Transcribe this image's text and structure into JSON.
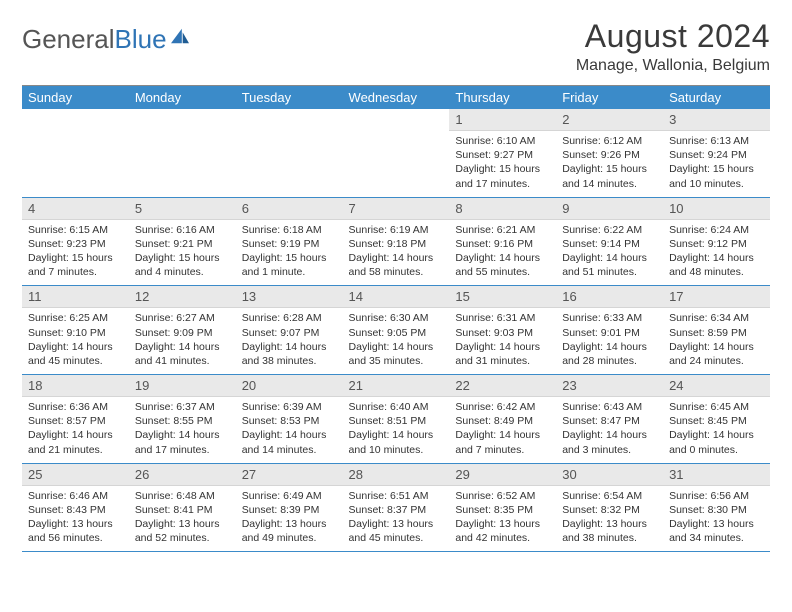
{
  "brand": {
    "part1": "General",
    "part2": "Blue"
  },
  "title": "August 2024",
  "subtitle": "Manage, Wallonia, Belgium",
  "dow": [
    "Sunday",
    "Monday",
    "Tuesday",
    "Wednesday",
    "Thursday",
    "Friday",
    "Saturday"
  ],
  "weeks": [
    [
      null,
      null,
      null,
      null,
      {
        "n": "1",
        "sr": "6:10 AM",
        "ss": "9:27 PM",
        "dl": "15 hours and 17 minutes."
      },
      {
        "n": "2",
        "sr": "6:12 AM",
        "ss": "9:26 PM",
        "dl": "15 hours and 14 minutes."
      },
      {
        "n": "3",
        "sr": "6:13 AM",
        "ss": "9:24 PM",
        "dl": "15 hours and 10 minutes."
      }
    ],
    [
      {
        "n": "4",
        "sr": "6:15 AM",
        "ss": "9:23 PM",
        "dl": "15 hours and 7 minutes."
      },
      {
        "n": "5",
        "sr": "6:16 AM",
        "ss": "9:21 PM",
        "dl": "15 hours and 4 minutes."
      },
      {
        "n": "6",
        "sr": "6:18 AM",
        "ss": "9:19 PM",
        "dl": "15 hours and 1 minute."
      },
      {
        "n": "7",
        "sr": "6:19 AM",
        "ss": "9:18 PM",
        "dl": "14 hours and 58 minutes."
      },
      {
        "n": "8",
        "sr": "6:21 AM",
        "ss": "9:16 PM",
        "dl": "14 hours and 55 minutes."
      },
      {
        "n": "9",
        "sr": "6:22 AM",
        "ss": "9:14 PM",
        "dl": "14 hours and 51 minutes."
      },
      {
        "n": "10",
        "sr": "6:24 AM",
        "ss": "9:12 PM",
        "dl": "14 hours and 48 minutes."
      }
    ],
    [
      {
        "n": "11",
        "sr": "6:25 AM",
        "ss": "9:10 PM",
        "dl": "14 hours and 45 minutes."
      },
      {
        "n": "12",
        "sr": "6:27 AM",
        "ss": "9:09 PM",
        "dl": "14 hours and 41 minutes."
      },
      {
        "n": "13",
        "sr": "6:28 AM",
        "ss": "9:07 PM",
        "dl": "14 hours and 38 minutes."
      },
      {
        "n": "14",
        "sr": "6:30 AM",
        "ss": "9:05 PM",
        "dl": "14 hours and 35 minutes."
      },
      {
        "n": "15",
        "sr": "6:31 AM",
        "ss": "9:03 PM",
        "dl": "14 hours and 31 minutes."
      },
      {
        "n": "16",
        "sr": "6:33 AM",
        "ss": "9:01 PM",
        "dl": "14 hours and 28 minutes."
      },
      {
        "n": "17",
        "sr": "6:34 AM",
        "ss": "8:59 PM",
        "dl": "14 hours and 24 minutes."
      }
    ],
    [
      {
        "n": "18",
        "sr": "6:36 AM",
        "ss": "8:57 PM",
        "dl": "14 hours and 21 minutes."
      },
      {
        "n": "19",
        "sr": "6:37 AM",
        "ss": "8:55 PM",
        "dl": "14 hours and 17 minutes."
      },
      {
        "n": "20",
        "sr": "6:39 AM",
        "ss": "8:53 PM",
        "dl": "14 hours and 14 minutes."
      },
      {
        "n": "21",
        "sr": "6:40 AM",
        "ss": "8:51 PM",
        "dl": "14 hours and 10 minutes."
      },
      {
        "n": "22",
        "sr": "6:42 AM",
        "ss": "8:49 PM",
        "dl": "14 hours and 7 minutes."
      },
      {
        "n": "23",
        "sr": "6:43 AM",
        "ss": "8:47 PM",
        "dl": "14 hours and 3 minutes."
      },
      {
        "n": "24",
        "sr": "6:45 AM",
        "ss": "8:45 PM",
        "dl": "14 hours and 0 minutes."
      }
    ],
    [
      {
        "n": "25",
        "sr": "6:46 AM",
        "ss": "8:43 PM",
        "dl": "13 hours and 56 minutes."
      },
      {
        "n": "26",
        "sr": "6:48 AM",
        "ss": "8:41 PM",
        "dl": "13 hours and 52 minutes."
      },
      {
        "n": "27",
        "sr": "6:49 AM",
        "ss": "8:39 PM",
        "dl": "13 hours and 49 minutes."
      },
      {
        "n": "28",
        "sr": "6:51 AM",
        "ss": "8:37 PM",
        "dl": "13 hours and 45 minutes."
      },
      {
        "n": "29",
        "sr": "6:52 AM",
        "ss": "8:35 PM",
        "dl": "13 hours and 42 minutes."
      },
      {
        "n": "30",
        "sr": "6:54 AM",
        "ss": "8:32 PM",
        "dl": "13 hours and 38 minutes."
      },
      {
        "n": "31",
        "sr": "6:56 AM",
        "ss": "8:30 PM",
        "dl": "13 hours and 34 minutes."
      }
    ]
  ],
  "labels": {
    "sunrise": "Sunrise: ",
    "sunset": "Sunset: ",
    "daylight": "Daylight: "
  }
}
